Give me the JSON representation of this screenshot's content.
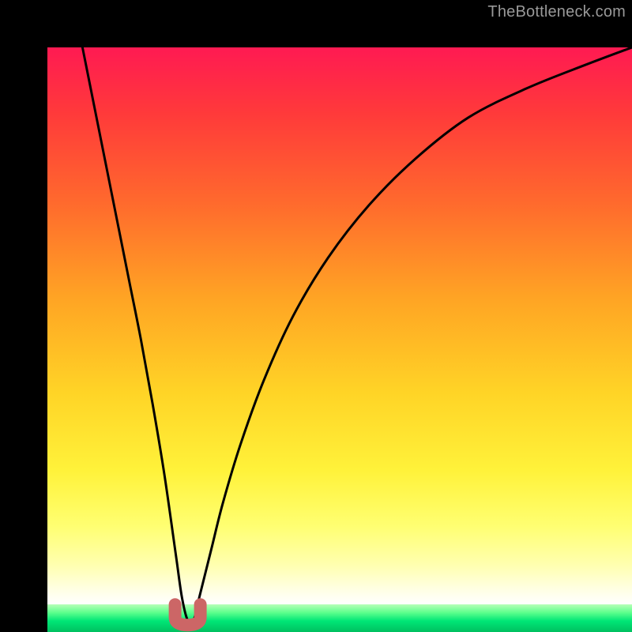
{
  "watermark": "TheBottleneck.com",
  "chart_data": {
    "type": "line",
    "title": "",
    "xlabel": "",
    "ylabel": "",
    "xlim": [
      0,
      100
    ],
    "ylim": [
      0,
      100
    ],
    "background_gradient": {
      "top_color": "#ff1a52",
      "mid_color": "#ffd426",
      "bottom_color": "#00c060"
    },
    "optimum_x": 24,
    "series": [
      {
        "name": "bottleneck-curve",
        "x": [
          6,
          8,
          10,
          12,
          14,
          16,
          18,
          20,
          22,
          23,
          24,
          25,
          26,
          28,
          30,
          33,
          37,
          42,
          48,
          55,
          63,
          72,
          82,
          92,
          100
        ],
        "values": [
          100,
          90,
          80,
          70,
          60,
          50,
          39,
          27,
          13,
          6,
          2,
          2,
          6,
          14,
          22,
          32,
          43,
          54,
          64,
          73,
          81,
          88,
          93,
          97,
          100
        ]
      }
    ],
    "marker": {
      "name": "optimum-marker",
      "color": "#cc6666",
      "x": 24,
      "y": 2
    }
  }
}
